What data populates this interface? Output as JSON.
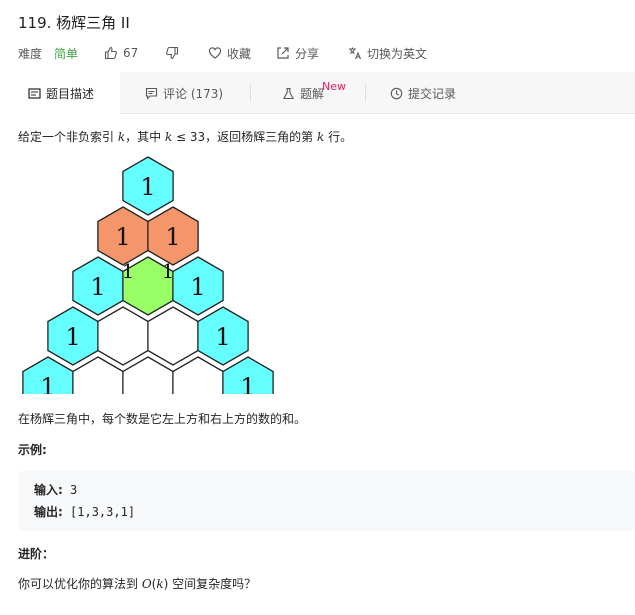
{
  "problem": {
    "title": "119. 杨辉三角 II",
    "difficulty_label": "难度",
    "difficulty": "简单",
    "likes": "67",
    "favorite_label": "收藏",
    "share_label": "分享",
    "lang_switch_label": "切换为英文"
  },
  "tabs": {
    "description": "题目描述",
    "comments": "评论 (173)",
    "solution": "题解",
    "solution_badge": "New",
    "submissions": "提交记录"
  },
  "body": {
    "desc_prefix": "给定一个非负索引 ",
    "desc_k1": "k",
    "desc_mid": "，其中 ",
    "desc_k2": "k",
    "desc_le": " ≤ 33，返回杨辉三角的第 ",
    "desc_k3": "k",
    "desc_suffix": " 行。",
    "caption": "在杨辉三角中，每个数是它左上方和右上方的数的和。",
    "example_title": "示例:",
    "input_label": "输入:",
    "input_value": " 3",
    "output_label": "输出:",
    "output_value": " [1,3,3,1]",
    "advance_title": "进阶：",
    "advance_prefix": "你可以优化你的算法到 ",
    "advance_o": "O",
    "advance_paren_open": "(",
    "advance_k": "k",
    "advance_paren_close": ")",
    "advance_suffix": " 空间复杂度吗？"
  },
  "diagram": {
    "cell_text": "1",
    "colors": {
      "cyan": "#66ffff",
      "orange": "#f4956a",
      "green": "#99ff66",
      "white": "#ffffff",
      "stroke": "#222222",
      "accent_green": "#43a047",
      "badge_pink": "#e91e63"
    }
  }
}
